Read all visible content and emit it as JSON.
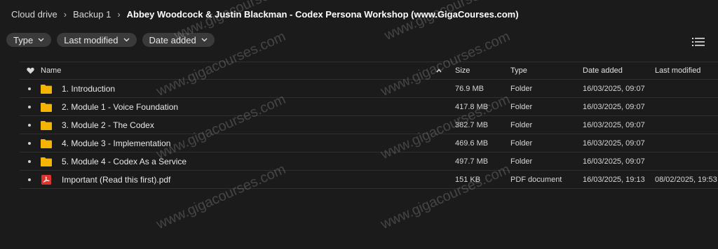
{
  "breadcrumb": {
    "items": [
      "Cloud drive",
      "Backup 1"
    ],
    "current": "Abbey Woodcock & Justin Blackman - Codex Persona Workshop (www.GigaCourses.com)"
  },
  "filters": [
    "Type",
    "Last modified",
    "Date added"
  ],
  "columns": {
    "name": "Name",
    "size": "Size",
    "type": "Type",
    "date_added": "Date added",
    "last_modified": "Last modified"
  },
  "rows": [
    {
      "name": "1. Introduction",
      "size": "76.9 MB",
      "type": "Folder",
      "date_added": "16/03/2025, 09:07",
      "last_modified": "",
      "icon": "folder-icon"
    },
    {
      "name": "2. Module 1 - Voice Foundation",
      "size": "417.8 MB",
      "type": "Folder",
      "date_added": "16/03/2025, 09:07",
      "last_modified": "",
      "icon": "folder-icon"
    },
    {
      "name": "3. Module 2 - The Codex",
      "size": "382.7 MB",
      "type": "Folder",
      "date_added": "16/03/2025, 09:07",
      "last_modified": "",
      "icon": "folder-icon"
    },
    {
      "name": "4. Module 3 - Implementation",
      "size": "469.6 MB",
      "type": "Folder",
      "date_added": "16/03/2025, 09:07",
      "last_modified": "",
      "icon": "folder-icon"
    },
    {
      "name": "5. Module 4 - Codex As a Service",
      "size": "497.7 MB",
      "type": "Folder",
      "date_added": "16/03/2025, 09:07",
      "last_modified": "",
      "icon": "folder-icon"
    },
    {
      "name": "Important (Read this first).pdf",
      "size": "151 KB",
      "type": "PDF document",
      "date_added": "16/03/2025, 19:13",
      "last_modified": "08/02/2025, 19:53",
      "icon": "pdf-icon"
    }
  ],
  "watermark": "www.gigacourses.com",
  "colors": {
    "background": "#1b1b1b",
    "folder": "#f5b400",
    "pdf": "#e0322d",
    "chip": "#3a3a3a"
  }
}
